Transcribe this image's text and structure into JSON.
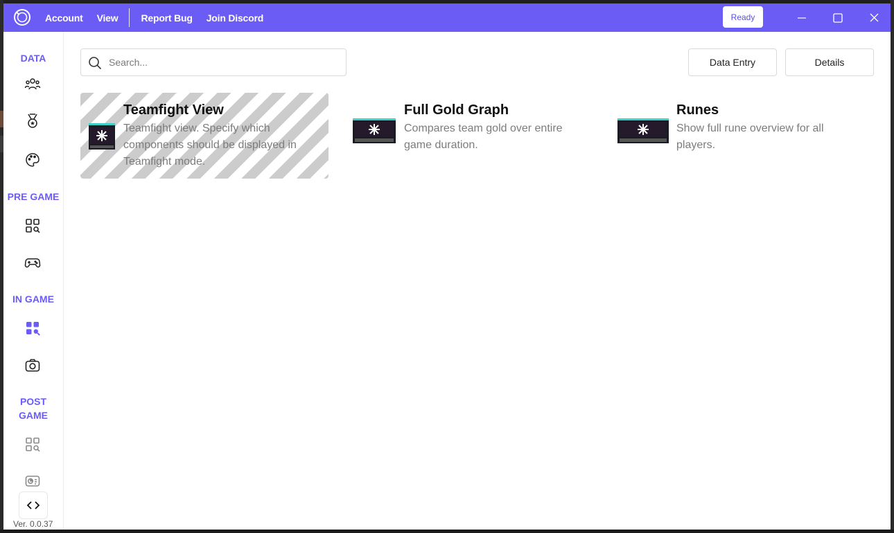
{
  "titlebar": {
    "menu": [
      "Account",
      "View",
      "Report Bug",
      "Join Discord"
    ],
    "status_button": "Ready"
  },
  "sidebar": {
    "sections": {
      "data": "DATA",
      "pre_game": "PRE GAME",
      "in_game": "IN GAME",
      "post_game_line1": "POST",
      "post_game_line2": "GAME"
    },
    "active_item": "in-game-overlays",
    "version": "Ver. 0.0.37"
  },
  "search": {
    "placeholder": "Search...",
    "value": ""
  },
  "toolbar": {
    "data_entry_label": "Data Entry",
    "details_label": "Details"
  },
  "overlays": [
    {
      "title": "Teamfight View",
      "description": "Teamfight view. Specify which components should be displayed in Teamfight mode.",
      "disabled": true
    },
    {
      "title": "Full Gold Graph",
      "description": "Compares team gold over entire game duration.",
      "disabled": false
    },
    {
      "title": "Runes",
      "description": "Show full rune overview for all players.",
      "disabled": false
    }
  ],
  "colors": {
    "accent": "#6b5cf6",
    "muted_text": "#7c7c7c",
    "stripe": "#cccccc"
  }
}
